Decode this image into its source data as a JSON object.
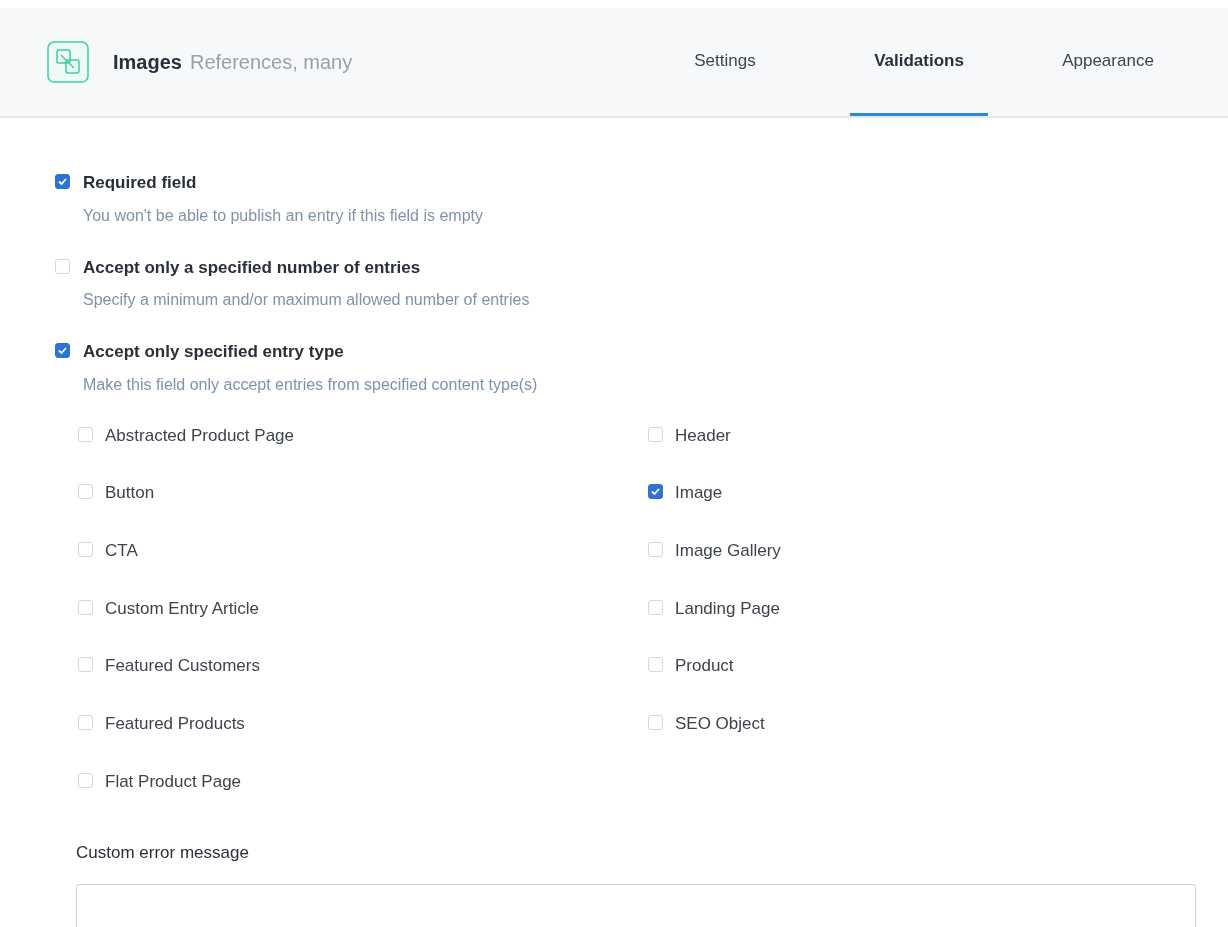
{
  "header": {
    "title": "Images",
    "subtitle": "References, many"
  },
  "tabs": [
    {
      "label": "Settings",
      "selected": false
    },
    {
      "label": "Validations",
      "selected": true
    },
    {
      "label": "Appearance",
      "selected": false
    }
  ],
  "validations": [
    {
      "label": "Required field",
      "description": "You won't be able to publish an entry if this field is empty",
      "checked": true
    },
    {
      "label": "Accept only a specified number of entries",
      "description": "Specify a minimum and/or maximum allowed number of entries",
      "checked": false
    },
    {
      "label": "Accept only specified entry type",
      "description": "Make this field only accept entries from specified content type(s)",
      "checked": true
    }
  ],
  "content_types": {
    "left": [
      {
        "label": "Abstracted Product Page",
        "checked": false
      },
      {
        "label": "Button",
        "checked": false
      },
      {
        "label": "CTA",
        "checked": false
      },
      {
        "label": "Custom Entry Article",
        "checked": false
      },
      {
        "label": "Featured Customers",
        "checked": false
      },
      {
        "label": "Featured Products",
        "checked": false
      },
      {
        "label": "Flat Product Page",
        "checked": false
      }
    ],
    "right": [
      {
        "label": "Header",
        "checked": false
      },
      {
        "label": "Image",
        "checked": true
      },
      {
        "label": "Image Gallery",
        "checked": false
      },
      {
        "label": "Landing Page",
        "checked": false
      },
      {
        "label": "Product",
        "checked": false
      },
      {
        "label": "SEO Object",
        "checked": false
      }
    ]
  },
  "custom_error": {
    "label": "Custom error message"
  }
}
